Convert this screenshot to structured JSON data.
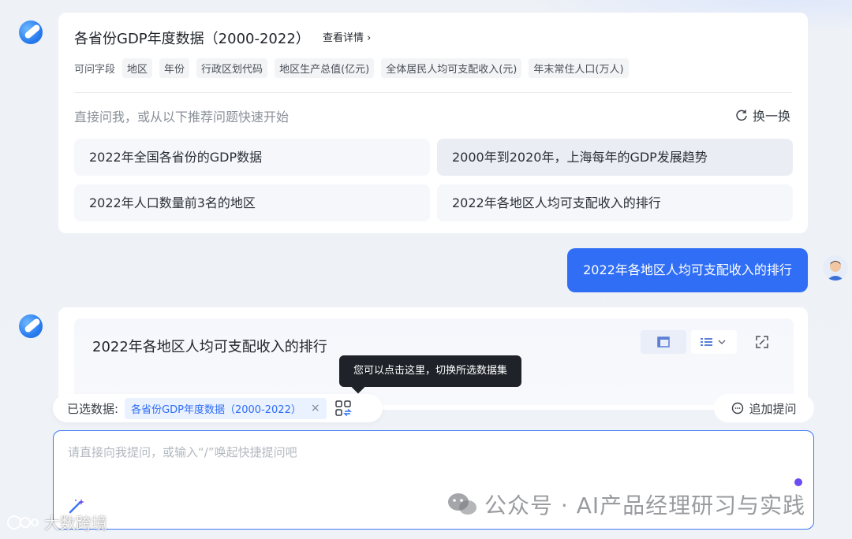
{
  "dataset_card": {
    "title": "各省份GDP年度数据（2000-2022）",
    "detail_link": "查看详情 ›",
    "fields_label": "可问字段",
    "fields": [
      "地区",
      "年份",
      "行政区划代码",
      "地区生产总值(亿元)",
      "全体居民人均可支配收入(元)",
      "年末常住人口(万人)"
    ],
    "hint": "直接问我，或从以下推荐问题快速开始",
    "refresh_label": "换一换",
    "questions": [
      "2022年全国各省份的GDP数据",
      "2000年到2020年，上海每年的GDP发展趋势",
      "2022年人口数量前3名的地区",
      "2022年各地区人均可支配收入的排行"
    ]
  },
  "user_message": "2022年各地区人均可支配收入的排行",
  "result_card": {
    "title": "2022年各地区人均可支配收入的排行"
  },
  "tooltip": "您可以点击这里，切换所选数据集",
  "selected_data": {
    "label": "已选数据:",
    "dataset": "各省份GDP年度数据（2000-2022）",
    "remove": "×"
  },
  "followup_button": "追加提问",
  "input": {
    "placeholder": "请直接向我提问，或输入“/”唤起快捷提问吧",
    "value": ""
  },
  "watermark": {
    "text": "公众号 · AI产品经理研习与实践",
    "brand": "大数跨境"
  },
  "colors": {
    "accent": "#2f6ef5",
    "send_dot": "#6b4cf0"
  }
}
